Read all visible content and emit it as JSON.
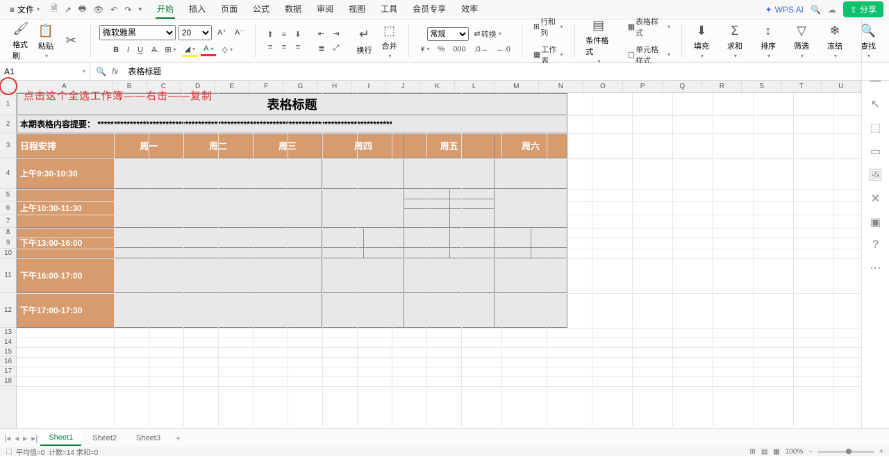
{
  "titlebar": {
    "file": "文件",
    "tabs": [
      "开始",
      "插入",
      "页面",
      "公式",
      "数据",
      "审阅",
      "视图",
      "工具",
      "会员专享",
      "效率"
    ],
    "active_tab": 0,
    "ai": "WPS AI",
    "share": "分享"
  },
  "ribbon": {
    "format_painter": "格式刷",
    "paste": "粘贴",
    "font_name": "微软雅黑",
    "font_size": "20",
    "wrap": "换行",
    "merge": "合并",
    "number_format": "常规",
    "convert": "转换",
    "rowcol": "行和列",
    "worksheet": "工作表",
    "cond_format": "条件格式",
    "table_style": "表格样式",
    "cell_style": "单元格样式",
    "fill": "填充",
    "sum": "求和",
    "sort": "排序",
    "filter": "筛选",
    "freeze": "冻结",
    "find": "查找"
  },
  "formula_bar": {
    "name": "A1",
    "value": "表格标题"
  },
  "columns": [
    "A",
    "B",
    "C",
    "D",
    "E",
    "F",
    "G",
    "H",
    "I",
    "J",
    "K",
    "L",
    "M",
    "N",
    "O",
    "P",
    "Q",
    "R",
    "S",
    "T",
    "U"
  ],
  "annotation": "点击这个全选工作簿——右击——复制",
  "content": {
    "title": "表格标题",
    "summary_label": "本期表格内容提要：",
    "summary_value": "*******************************************************************************************",
    "schedule_label": "日程安排",
    "days": [
      "周一",
      "周二",
      "周三",
      "周四",
      "周五",
      "周六"
    ],
    "times": [
      "上午9:30-10:30",
      "上午10:30-11:30",
      "下午13:00-16:00",
      "下午16:00-17:00",
      "下午17:00-17:30"
    ]
  },
  "sheets": {
    "tabs": [
      "Sheet1",
      "Sheet2",
      "Sheet3"
    ],
    "active": 0
  },
  "status": {
    "avg": "平均值=0",
    "count": "计数=14",
    "sum": "求和=0",
    "zoom": "100%"
  }
}
